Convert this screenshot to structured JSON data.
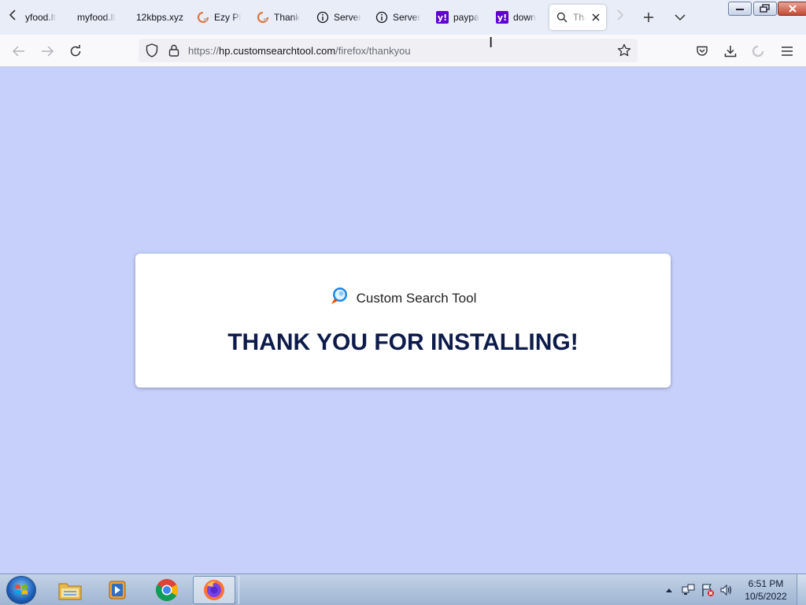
{
  "browser": {
    "tabs": [
      {
        "label": "yfood.lt",
        "favicon": "none"
      },
      {
        "label": "myfood.lt",
        "favicon": "none"
      },
      {
        "label": "12kbps.xyz",
        "favicon": "none"
      },
      {
        "label": "Ezy PD",
        "favicon": "orange-c-icon"
      },
      {
        "label": "Thank",
        "favicon": "orange-c-icon"
      },
      {
        "label": "Server",
        "favicon": "info-icon"
      },
      {
        "label": "Server",
        "favicon": "info-icon"
      },
      {
        "label": "paypa",
        "favicon": "yahoo-icon"
      },
      {
        "label": "down",
        "favicon": "yahoo-icon"
      },
      {
        "label": "Tha",
        "favicon": "search-icon",
        "active": true
      }
    ],
    "url": {
      "scheme": "https://",
      "host": "hp.customsearchtool.com",
      "path": "/firefox/thankyou"
    }
  },
  "page": {
    "brand_name": "Custom Search Tool",
    "headline": "THANK YOU FOR INSTALLING!"
  },
  "taskbar": {
    "time": "6:51 PM",
    "date": "10/5/2022"
  },
  "colors": {
    "page_background": "#c6d0fb",
    "headline": "#0d1b4b",
    "yahoo_purple": "#6001d2"
  }
}
